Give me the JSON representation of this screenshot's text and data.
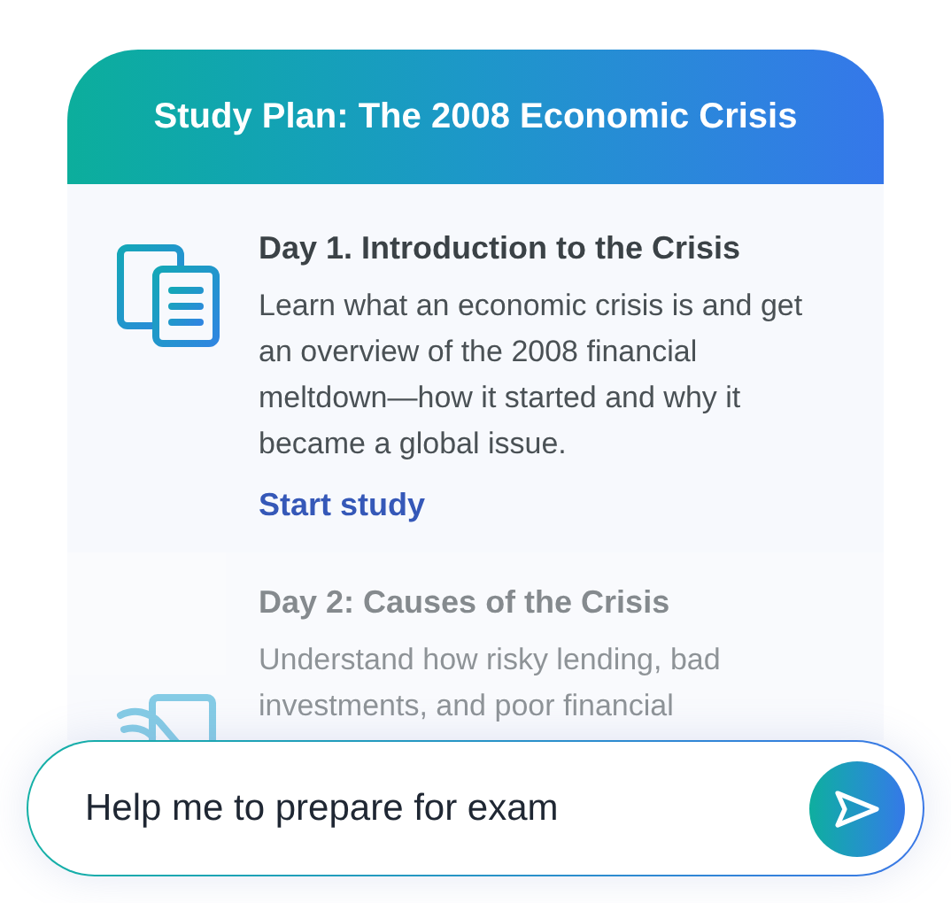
{
  "card": {
    "title": "Study Plan: The 2008 Economic Crisis",
    "days": [
      {
        "title": "Day 1. Introduction to the Crisis",
        "description": "Learn what an economic crisis is and get an overview of the 2008 financial meltdown—how it started and why it became a global issue.",
        "link": "Start study",
        "dimmed": false
      },
      {
        "title": "Day 2: Causes of the Crisis",
        "description": "Understand how risky lending, bad investments, and poor financial",
        "dimmed": true
      }
    ]
  },
  "chat_input": {
    "value": "Help me to prepare for exam"
  }
}
